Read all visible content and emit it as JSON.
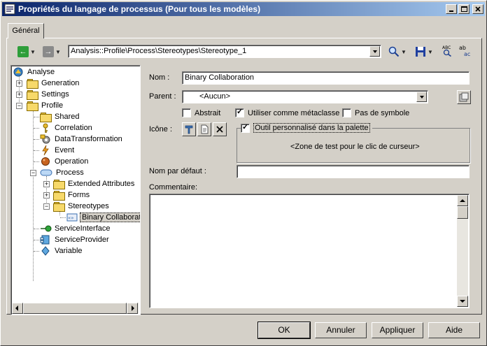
{
  "window": {
    "title": "Propriétés du langage de processus  (Pour tous les modèles)"
  },
  "tabs": [
    {
      "label": "Général"
    }
  ],
  "toolbar": {
    "path": "Analysis::Profile\\Process\\Stereotypes\\Stereotype_1"
  },
  "tree": {
    "items": [
      {
        "label": "Analyse"
      },
      {
        "label": "Generation"
      },
      {
        "label": "Settings"
      },
      {
        "label": "Profile"
      },
      {
        "label": "Shared"
      },
      {
        "label": "Correlation"
      },
      {
        "label": "DataTransformation"
      },
      {
        "label": "Event"
      },
      {
        "label": "Operation"
      },
      {
        "label": "Process"
      },
      {
        "label": "Extended Attributes"
      },
      {
        "label": "Forms"
      },
      {
        "label": "Stereotypes"
      },
      {
        "label": "Binary Collaborat"
      },
      {
        "label": "ServiceInterface"
      },
      {
        "label": "ServiceProvider"
      },
      {
        "label": "Variable"
      }
    ]
  },
  "form": {
    "name_label": "Nom :",
    "name_value": "Binary Collaboration",
    "parent_label": "Parent :",
    "parent_value": "<Aucun>",
    "abstract_label": "Abstrait",
    "metaclass_label": "Utiliser comme métaclasse",
    "nosymbol_label": "Pas de symbole",
    "icon_label": "Icône :",
    "custom_tool_label": "Outil personnalisé dans la palette",
    "test_zone": "<Zone de test pour le clic de curseur>",
    "default_name_label": "Nom par défaut :",
    "default_name_value": "",
    "comment_label": "Commentaire:"
  },
  "buttons": {
    "ok": "OK",
    "cancel": "Annuler",
    "apply": "Appliquer",
    "help": "Aide"
  },
  "colors": {
    "title_start": "#0a246a",
    "title_end": "#a6caf0",
    "face": "#d4d0c8",
    "nav_back": "#2e9e3a",
    "nav_forward": "#8a8a8a"
  }
}
